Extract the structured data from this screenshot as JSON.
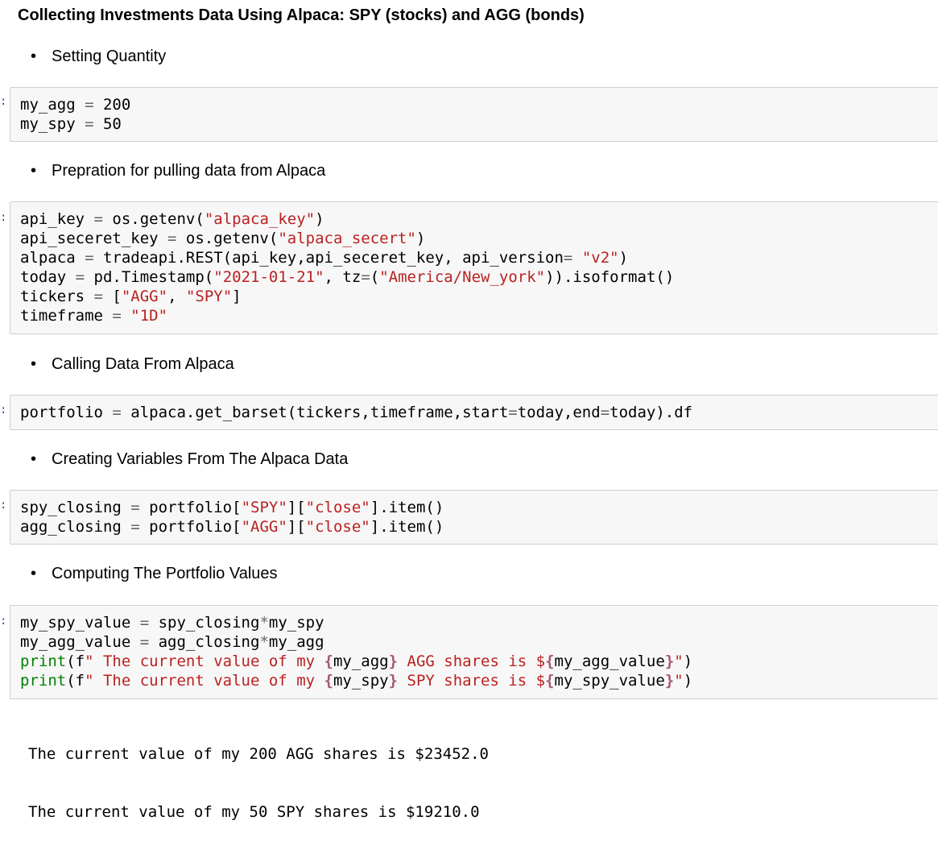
{
  "title": "Collecting Investments Data Using Alpaca: SPY (stocks) and AGG (bonds)",
  "bullet_glyph": "•",
  "prompt_glyph": ":",
  "sections": [
    {
      "heading": "Setting Quantity",
      "lines": [
        [
          {
            "t": "my_agg "
          },
          {
            "t": "=",
            "c": "o"
          },
          {
            "t": " 200"
          }
        ],
        [
          {
            "t": "my_spy "
          },
          {
            "t": "=",
            "c": "o"
          },
          {
            "t": " 50"
          }
        ]
      ]
    },
    {
      "heading": "Prepration for pulling data from Alpaca",
      "lines": [
        [
          {
            "t": "api_key "
          },
          {
            "t": "=",
            "c": "o"
          },
          {
            "t": " os.getenv("
          },
          {
            "t": "\"alpaca_key\"",
            "c": "s"
          },
          {
            "t": ")"
          }
        ],
        [
          {
            "t": "api_seceret_key "
          },
          {
            "t": "=",
            "c": "o"
          },
          {
            "t": " os.getenv("
          },
          {
            "t": "\"alpaca_secert\"",
            "c": "s"
          },
          {
            "t": ")"
          }
        ],
        [
          {
            "t": "alpaca "
          },
          {
            "t": "=",
            "c": "o"
          },
          {
            "t": " tradeapi.REST(api_key,api_seceret_key, api_version"
          },
          {
            "t": "=",
            "c": "o"
          },
          {
            "t": " "
          },
          {
            "t": "\"v2\"",
            "c": "s"
          },
          {
            "t": ")"
          }
        ],
        [
          {
            "t": "today "
          },
          {
            "t": "=",
            "c": "o"
          },
          {
            "t": " pd.Timestamp("
          },
          {
            "t": "\"2021-01-21\"",
            "c": "s"
          },
          {
            "t": ", tz"
          },
          {
            "t": "=",
            "c": "o"
          },
          {
            "t": "("
          },
          {
            "t": "\"America/New_york\"",
            "c": "s"
          },
          {
            "t": ")).isoformat()"
          }
        ],
        [
          {
            "t": "tickers "
          },
          {
            "t": "=",
            "c": "o"
          },
          {
            "t": " ["
          },
          {
            "t": "\"AGG\"",
            "c": "s"
          },
          {
            "t": ", "
          },
          {
            "t": "\"SPY\"",
            "c": "s"
          },
          {
            "t": "]"
          }
        ],
        [
          {
            "t": "timeframe "
          },
          {
            "t": "=",
            "c": "o"
          },
          {
            "t": " "
          },
          {
            "t": "\"1D\"",
            "c": "s"
          }
        ]
      ]
    },
    {
      "heading": "Calling Data From Alpaca",
      "lines": [
        [
          {
            "t": "portfolio "
          },
          {
            "t": "=",
            "c": "o"
          },
          {
            "t": " alpaca.get_barset(tickers,timeframe,start"
          },
          {
            "t": "=",
            "c": "o"
          },
          {
            "t": "today,end"
          },
          {
            "t": "=",
            "c": "o"
          },
          {
            "t": "today).df"
          }
        ]
      ]
    },
    {
      "heading": "Creating Variables From The Alpaca Data",
      "lines": [
        [
          {
            "t": "spy_closing "
          },
          {
            "t": "=",
            "c": "o"
          },
          {
            "t": " portfolio["
          },
          {
            "t": "\"SPY\"",
            "c": "s"
          },
          {
            "t": "]["
          },
          {
            "t": "\"close\"",
            "c": "s"
          },
          {
            "t": "].item()"
          }
        ],
        [
          {
            "t": "agg_closing "
          },
          {
            "t": "=",
            "c": "o"
          },
          {
            "t": " portfolio["
          },
          {
            "t": "\"AGG\"",
            "c": "s"
          },
          {
            "t": "]["
          },
          {
            "t": "\"close\"",
            "c": "s"
          },
          {
            "t": "].item()"
          }
        ]
      ]
    },
    {
      "heading": "Computing The Portfolio Values",
      "lines": [
        [
          {
            "t": "my_spy_value "
          },
          {
            "t": "=",
            "c": "o"
          },
          {
            "t": " spy_closing"
          },
          {
            "t": "*",
            "c": "o"
          },
          {
            "t": "my_spy"
          }
        ],
        [
          {
            "t": "my_agg_value "
          },
          {
            "t": "=",
            "c": "o"
          },
          {
            "t": " agg_closing"
          },
          {
            "t": "*",
            "c": "o"
          },
          {
            "t": "my_agg"
          }
        ],
        [
          {
            "t": "print",
            "c": "k"
          },
          {
            "t": "(f"
          },
          {
            "t": "\" The current value of my ",
            "c": "s"
          },
          {
            "t": "{",
            "c": "si"
          },
          {
            "t": "my_agg"
          },
          {
            "t": "}",
            "c": "si"
          },
          {
            "t": " AGG shares is $",
            "c": "s"
          },
          {
            "t": "{",
            "c": "si"
          },
          {
            "t": "my_agg_value"
          },
          {
            "t": "}",
            "c": "si"
          },
          {
            "t": "\"",
            "c": "s"
          },
          {
            "t": ")"
          }
        ],
        [
          {
            "t": "print",
            "c": "k"
          },
          {
            "t": "(f"
          },
          {
            "t": "\" The current value of my ",
            "c": "s"
          },
          {
            "t": "{",
            "c": "si"
          },
          {
            "t": "my_spy"
          },
          {
            "t": "}",
            "c": "si"
          },
          {
            "t": " SPY shares is $",
            "c": "s"
          },
          {
            "t": "{",
            "c": "si"
          },
          {
            "t": "my_spy_value"
          },
          {
            "t": "}",
            "c": "si"
          },
          {
            "t": "\"",
            "c": "s"
          },
          {
            "t": ")"
          }
        ]
      ],
      "output": [
        "The current value of my 200 AGG shares is $23452.0",
        "The current value of my 50 SPY shares is $19210.0"
      ]
    }
  ]
}
